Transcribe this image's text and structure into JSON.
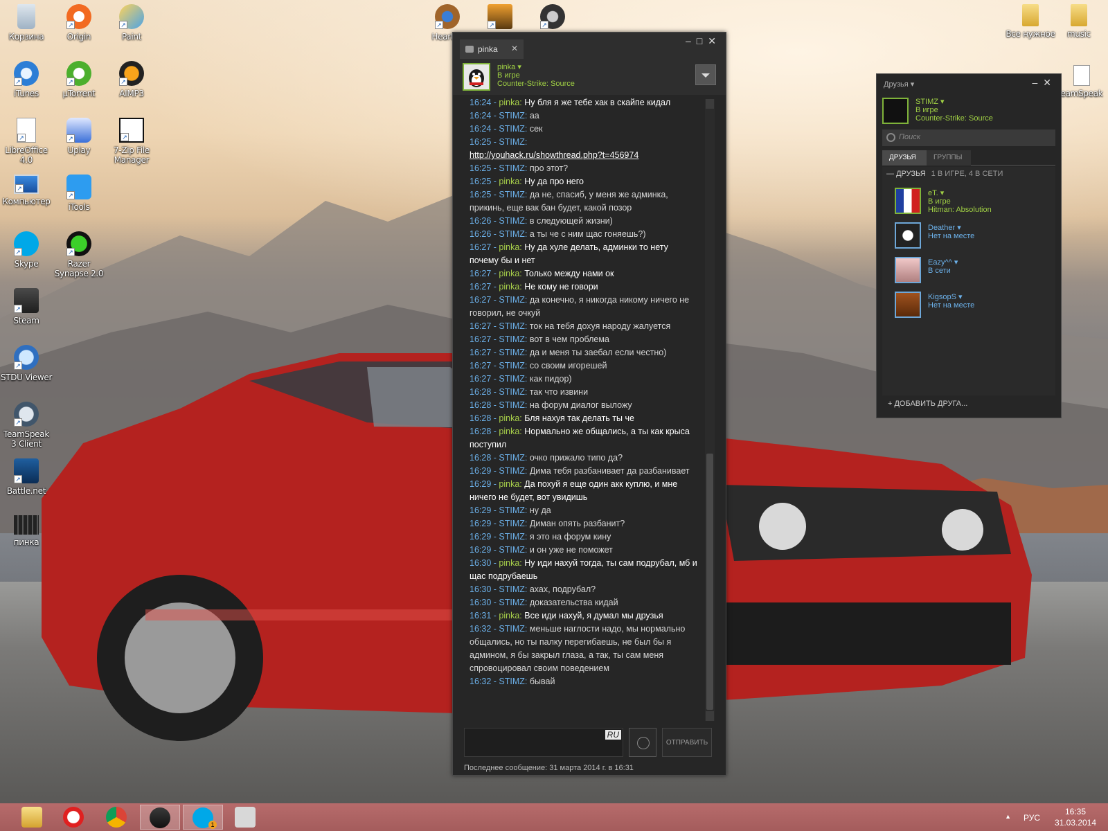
{
  "desktop_icons": [
    {
      "label": "Корзина"
    },
    {
      "label": "Origin"
    },
    {
      "label": "Paint"
    },
    {
      "label": "iTunes"
    },
    {
      "label": "µTorrent"
    },
    {
      "label": "AIMP3"
    },
    {
      "label": "LibreOffice 4.0"
    },
    {
      "label": "Uplay"
    },
    {
      "label": "7-Zip File Manager"
    },
    {
      "label": "Компьютер"
    },
    {
      "label": "iTools"
    },
    {
      "label": "Skype"
    },
    {
      "label": "Razer Synapse 2.0"
    },
    {
      "label": "Steam"
    },
    {
      "label": "STDU Viewer"
    },
    {
      "label": "TeamSpeak 3 Client"
    },
    {
      "label": "Battle.net"
    },
    {
      "label": "пинка"
    },
    {
      "label": "Hearths"
    },
    {
      "label": "Все нужное"
    },
    {
      "label": "music"
    },
    {
      "label": "eamSpeak"
    }
  ],
  "chat": {
    "tab_label": "pinka",
    "header": {
      "name": "pinka",
      "status": "В игре",
      "game": "Counter-Strike: Source"
    },
    "messages": [
      {
        "time": "16:24",
        "user": "pinka",
        "text": "Ну бля я же тебе хак в скайпе кидал"
      },
      {
        "time": "16:24",
        "user": "STIMZ",
        "text": "аа"
      },
      {
        "time": "16:24",
        "user": "STIMZ",
        "text": "сек"
      },
      {
        "time": "16:25",
        "user": "STIMZ",
        "text": "",
        "link": "http://youhack.ru/showthread.php?t=456974"
      },
      {
        "time": "16:25",
        "user": "STIMZ",
        "text": "про этот?"
      },
      {
        "time": "16:25",
        "user": "pinka",
        "text": "Ну да про него"
      },
      {
        "time": "16:25",
        "user": "STIMZ",
        "text": "да не, спасиб, у меня же админка, прикинь, еще вак бан будет, какой позор"
      },
      {
        "time": "16:26",
        "user": "STIMZ",
        "text": "в следующей жизни)"
      },
      {
        "time": "16:26",
        "user": "STIMZ",
        "text": "а ты че с ним щас гоняешь?)"
      },
      {
        "time": "16:27",
        "user": "pinka",
        "text": "Ну да хуле делать, админки то нету почему бы и нет"
      },
      {
        "time": "16:27",
        "user": "pinka",
        "text": "Только между нами ок"
      },
      {
        "time": "16:27",
        "user": "pinka",
        "text": "Не кому не говори"
      },
      {
        "time": "16:27",
        "user": "STIMZ",
        "text": "да конечно, я никогда никому ничего не говорил, не очкуй"
      },
      {
        "time": "16:27",
        "user": "STIMZ",
        "text": "ток на тебя дохуя народу жалуется"
      },
      {
        "time": "16:27",
        "user": "STIMZ",
        "text": "вот в чем проблема"
      },
      {
        "time": "16:27",
        "user": "STIMZ",
        "text": "да и меня ты заебал если честно)"
      },
      {
        "time": "16:27",
        "user": "STIMZ",
        "text": "со своим игорешей"
      },
      {
        "time": "16:27",
        "user": "STIMZ",
        "text": "как пидор)"
      },
      {
        "time": "16:28",
        "user": "STIMZ",
        "text": "так что извини"
      },
      {
        "time": "16:28",
        "user": "STIMZ",
        "text": "на форум диалог выложу"
      },
      {
        "time": "16:28",
        "user": "pinka",
        "text": "Бля нахуя так делать ты че"
      },
      {
        "time": "16:28",
        "user": "pinka",
        "text": "Нормально же общались, а ты как крыса поступил"
      },
      {
        "time": "16:28",
        "user": "STIMZ",
        "text": "очко прижало типо да?"
      },
      {
        "time": "16:29",
        "user": "STIMZ",
        "text": "Дима тебя разбанивает да разбанивает"
      },
      {
        "time": "16:29",
        "user": "pinka",
        "text": "Да похуй я еще один акк куплю, и мне ничего не будет, вот увидишь"
      },
      {
        "time": "16:29",
        "user": "STIMZ",
        "text": "ну да"
      },
      {
        "time": "16:29",
        "user": "STIMZ",
        "text": "Диман опять разбанит?"
      },
      {
        "time": "16:29",
        "user": "STIMZ",
        "text": "я это на форум кину"
      },
      {
        "time": "16:29",
        "user": "STIMZ",
        "text": "и он уже не поможет"
      },
      {
        "time": "16:30",
        "user": "pinka",
        "text": "Ну иди нахуй тогда, ты сам подрубал, мб и щас подрубаешь"
      },
      {
        "time": "16:30",
        "user": "STIMZ",
        "text": "ахах, подрубал?"
      },
      {
        "time": "16:30",
        "user": "STIMZ",
        "text": "доказательства кидай"
      },
      {
        "time": "16:31",
        "user": "pinka",
        "text": "Все иди нахуй, я думал мы друзья"
      },
      {
        "time": "16:32",
        "user": "STIMZ",
        "text": "меньше наглости надо, мы нормально общались, но ты палку перегибаешь, не был бы я админом, я бы закрыл глаза, а так, ты сам меня спровоцировал своим поведением"
      },
      {
        "time": "16:32",
        "user": "STIMZ",
        "text": "бывай"
      }
    ],
    "input_lang": "RU",
    "send_label": "ОТПРАВИТЬ",
    "footer": "Последнее сообщение: 31 марта 2014 г. в 16:31"
  },
  "friends": {
    "title": "Друзья",
    "me": {
      "name": "STIMZ",
      "status": "В игре",
      "game": "Counter-Strike: Source"
    },
    "search_placeholder": "Поиск",
    "tabs": [
      "ДРУЗЬЯ",
      "ГРУППЫ"
    ],
    "group_label": "ДРУЗЬЯ",
    "group_counts": "1 В ИГРЕ, 4 В СЕТИ",
    "list": [
      {
        "name": "eT.",
        "status": "В игре",
        "game": "Hitman: Absolution",
        "ingame": true
      },
      {
        "name": "Deather",
        "status": "Нет на месте",
        "game": ""
      },
      {
        "name": "Eazy^^",
        "status": "В сети",
        "game": ""
      },
      {
        "name": "KigsopS",
        "status": "Нет на месте",
        "game": ""
      }
    ],
    "add_label": "ДОБАВИТЬ ДРУГА..."
  },
  "taskbar": {
    "apps": [
      "explorer-icon",
      "yandex-icon",
      "chrome-icon",
      "steam-icon",
      "skype-icon",
      "counter-strike-icon"
    ],
    "skype_badge": "1",
    "tray_lang": "РУС",
    "time": "16:35",
    "date": "31.03.2014"
  }
}
